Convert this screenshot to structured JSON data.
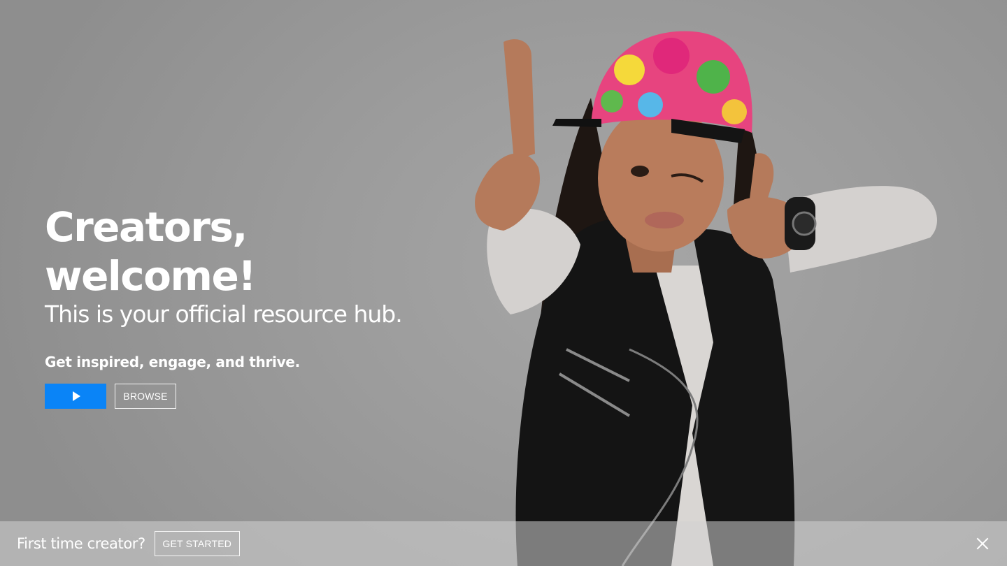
{
  "hero": {
    "title": "Creators, welcome!",
    "subtitle": "This is your official resource hub.",
    "tagline": "Get inspired, engage, and thrive.",
    "play_icon": "play-icon",
    "browse_label": "BROWSE"
  },
  "bottom_bar": {
    "label": "First time creator?",
    "cta_label": "GET STARTED",
    "close_icon": "close-icon"
  },
  "colors": {
    "accent": "#0a84f7",
    "background": "#9c9c9c",
    "text": "#ffffff"
  }
}
